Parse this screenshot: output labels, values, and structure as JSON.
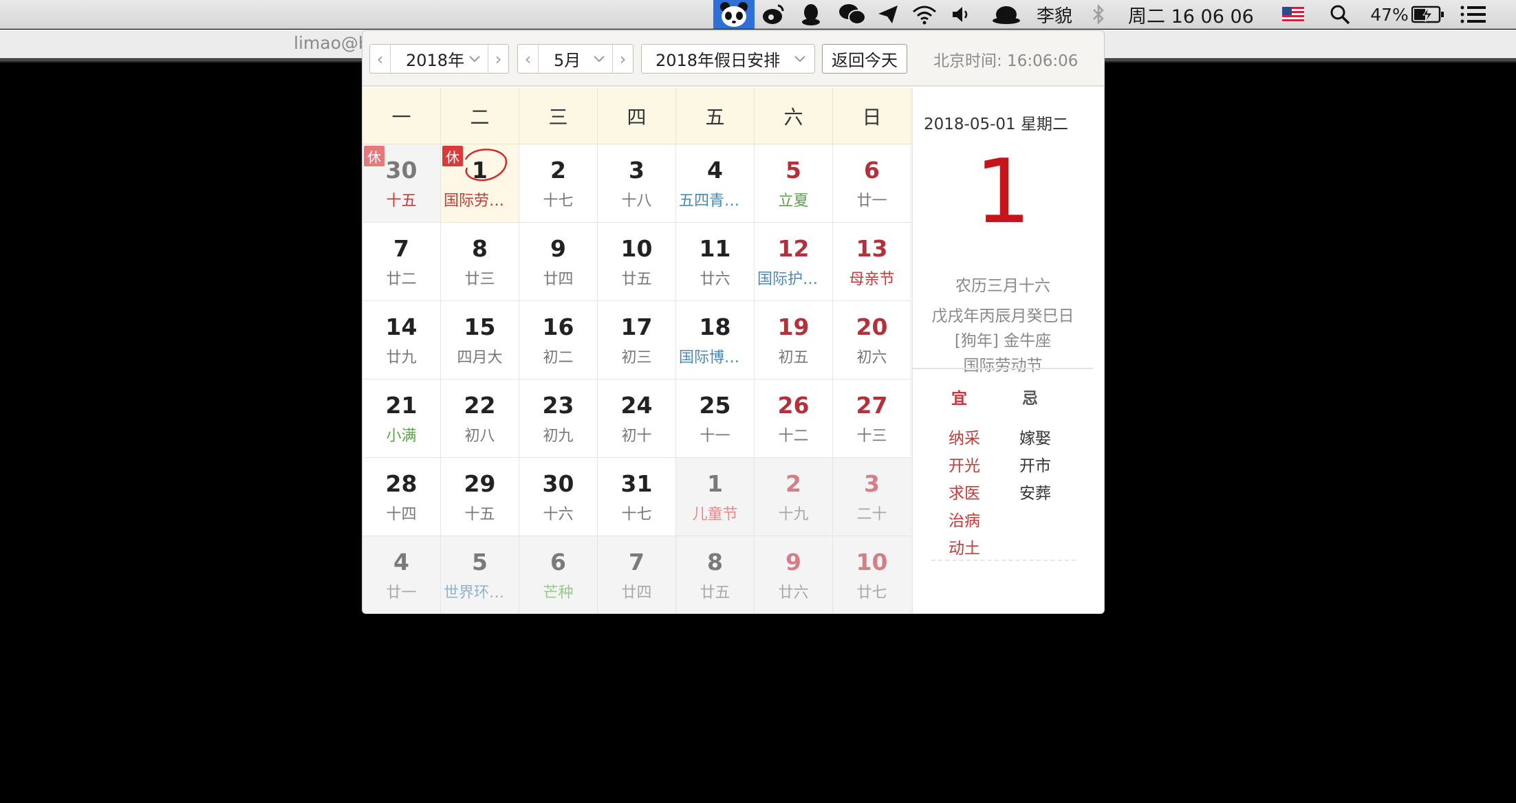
{
  "menubar": {
    "user": "李貌",
    "clock": "周二 16 06 06",
    "battery": "47%"
  },
  "terminal": {
    "title": "limao@b"
  },
  "calendar": {
    "year_value": "2018年",
    "month_value": "5月",
    "holiday_value": "2018年假日安排",
    "today_button": "返回今天",
    "beijing_time": "北京时间: 16:06:06",
    "weekdays": [
      "一",
      "二",
      "三",
      "四",
      "五",
      "六",
      "日"
    ],
    "rest_badge": "休",
    "days": [
      {
        "n": "30",
        "s": "十五",
        "sc": "c-red",
        "other": true,
        "rest": true
      },
      {
        "n": "1",
        "s": "国际劳动节",
        "sc": "c-red",
        "sel": true,
        "rest": true
      },
      {
        "n": "2",
        "s": "十七"
      },
      {
        "n": "3",
        "s": "十八"
      },
      {
        "n": "4",
        "s": "五四青年节",
        "sc": "c-blue"
      },
      {
        "n": "5",
        "s": "立夏",
        "sc": "c-green",
        "we": true
      },
      {
        "n": "6",
        "s": "廿一",
        "we": true
      },
      {
        "n": "7",
        "s": "廿二"
      },
      {
        "n": "8",
        "s": "廿三"
      },
      {
        "n": "9",
        "s": "廿四"
      },
      {
        "n": "10",
        "s": "廿五"
      },
      {
        "n": "11",
        "s": "廿六"
      },
      {
        "n": "12",
        "s": "国际护士节",
        "sc": "c-blue",
        "we": true
      },
      {
        "n": "13",
        "s": "母亲节",
        "sc": "c-red",
        "we": true
      },
      {
        "n": "14",
        "s": "廿九"
      },
      {
        "n": "15",
        "s": "四月大"
      },
      {
        "n": "16",
        "s": "初二"
      },
      {
        "n": "17",
        "s": "初三"
      },
      {
        "n": "18",
        "s": "国际博物馆日",
        "sc": "c-blue"
      },
      {
        "n": "19",
        "s": "初五",
        "we": true
      },
      {
        "n": "20",
        "s": "初六",
        "we": true
      },
      {
        "n": "21",
        "s": "小满",
        "sc": "c-green"
      },
      {
        "n": "22",
        "s": "初八"
      },
      {
        "n": "23",
        "s": "初九"
      },
      {
        "n": "24",
        "s": "初十"
      },
      {
        "n": "25",
        "s": "十一"
      },
      {
        "n": "26",
        "s": "十二",
        "we": true
      },
      {
        "n": "27",
        "s": "十三",
        "we": true
      },
      {
        "n": "28",
        "s": "十四"
      },
      {
        "n": "29",
        "s": "十五"
      },
      {
        "n": "30",
        "s": "十六"
      },
      {
        "n": "31",
        "s": "十七"
      },
      {
        "n": "1",
        "s": "儿童节",
        "sc": "c-lightred",
        "other": true
      },
      {
        "n": "2",
        "s": "十九",
        "sc": "c-light",
        "other": true,
        "we": true
      },
      {
        "n": "3",
        "s": "二十",
        "sc": "c-light",
        "other": true,
        "we": true
      },
      {
        "n": "4",
        "s": "廿一",
        "sc": "c-light",
        "other": true
      },
      {
        "n": "5",
        "s": "世界环境日",
        "sc": "c-lightblue",
        "other": true
      },
      {
        "n": "6",
        "s": "芒种",
        "sc": "c-lightgreen",
        "other": true
      },
      {
        "n": "7",
        "s": "廿四",
        "sc": "c-light",
        "other": true
      },
      {
        "n": "8",
        "s": "廿五",
        "sc": "c-light",
        "other": true
      },
      {
        "n": "9",
        "s": "廿六",
        "sc": "c-light",
        "other": true,
        "we": true
      },
      {
        "n": "10",
        "s": "廿七",
        "sc": "c-light",
        "other": true,
        "we": true
      }
    ]
  },
  "detail": {
    "date": "2018-05-01  星期二",
    "big_day": "1",
    "lunar": "农历三月十六",
    "ganzhi": "戊戌年丙辰月癸巳日",
    "zodiac": "[狗年] 金牛座",
    "festival": "国际劳动节",
    "yi_label": "宜",
    "ji_label": "忌",
    "yi": [
      "纳采",
      "开光",
      "求医",
      "治病",
      "动土"
    ],
    "ji": [
      "嫁娶",
      "开市",
      "安葬"
    ]
  },
  "colors": {
    "accent_red": "#c7141a",
    "weekend_red": "#b4303a",
    "header_cream": "#fdf8e3"
  }
}
